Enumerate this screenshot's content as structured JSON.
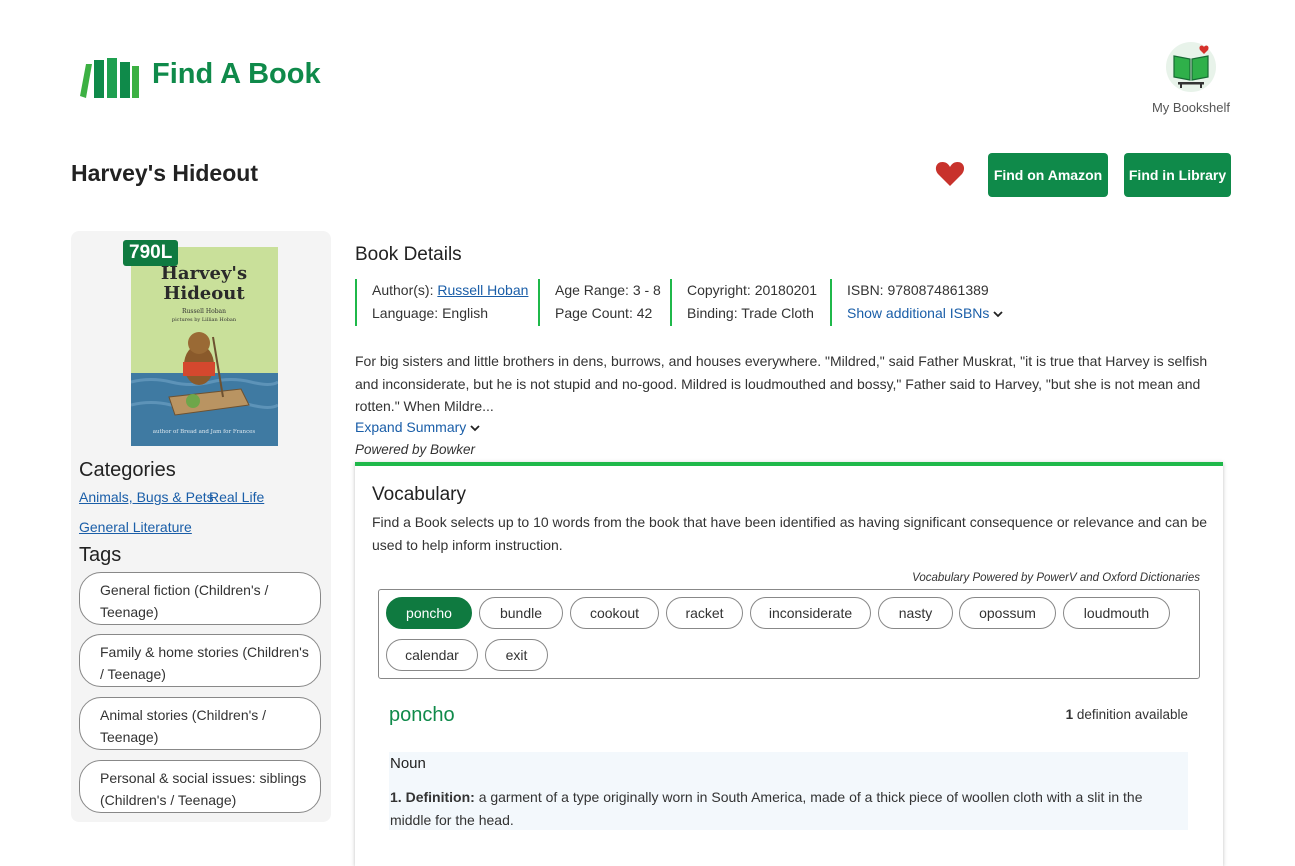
{
  "header": {
    "brand": "Find A Book",
    "bookshelf_label": "My Bookshelf",
    "colors": {
      "brand_green": "#0f8a4a",
      "accent_green": "#1fb84a",
      "heart_red": "#c8322c"
    }
  },
  "book": {
    "title": "Harvey's Hideout",
    "lexile": "790L",
    "cover_text": {
      "title_line1": "Harvey's",
      "title_line2": "Hideout",
      "author": "Russell Hoban",
      "illustrator": "pictures by Lillian Hoban",
      "footer": "author of Bread and Jam for Frances"
    }
  },
  "actions": {
    "amazon": "Find on Amazon",
    "library": "Find in Library"
  },
  "categories": {
    "heading": "Categories",
    "items": [
      "Animals, Bugs & Pets",
      "Real Life",
      "General Literature"
    ]
  },
  "tags": {
    "heading": "Tags",
    "items": [
      "General fiction (Children's / Teenage)",
      "Family & home stories (Children's / Teenage)",
      "Animal stories (Children's / Teenage)",
      "Personal & social issues: siblings (Children's / Teenage)"
    ]
  },
  "details": {
    "heading": "Book Details",
    "author_label": "Author(s):",
    "author": "Russell Hoban",
    "language": "Language: English",
    "age_range": "Age Range: 3 - 8",
    "page_count": "Page Count: 42",
    "copyright": "Copyright: 20180201",
    "binding": "Binding: Trade Cloth",
    "isbn": "ISBN: 9780874861389",
    "show_isbns": "Show additional ISBNs"
  },
  "summary": {
    "text": "For big sisters and little brothers in dens, burrows, and houses everywhere. \"Mildred,\" said Father Muskrat, \"it is true that Harvey is selfish and inconsiderate, but he is not stupid and no-good. Mildred is loudmouthed and bossy,\" Father said to Harvey, \"but she is not mean and rotten.\" When Mildre...",
    "expand": "Expand Summary",
    "powered": "Powered by Bowker"
  },
  "vocabulary": {
    "heading": "Vocabulary",
    "description": "Find a Book selects up to 10 words from the book that have been identified as having significant consequence or relevance and can be used to help inform instruction.",
    "powered": "Vocabulary Powered by PowerV and Oxford Dictionaries",
    "words": [
      "poncho",
      "bundle",
      "cookout",
      "racket",
      "inconsiderate",
      "nasty",
      "opossum",
      "loudmouth",
      "calendar",
      "exit"
    ],
    "selected": "poncho",
    "definition": {
      "word": "poncho",
      "count_num": "1",
      "count_text": " definition available",
      "part_of_speech": "Noun",
      "number": "1.",
      "label": "Definition:",
      "text": "a garment of a type originally worn in South America, made of a thick piece of woollen cloth with a slit in the middle for the head."
    }
  }
}
